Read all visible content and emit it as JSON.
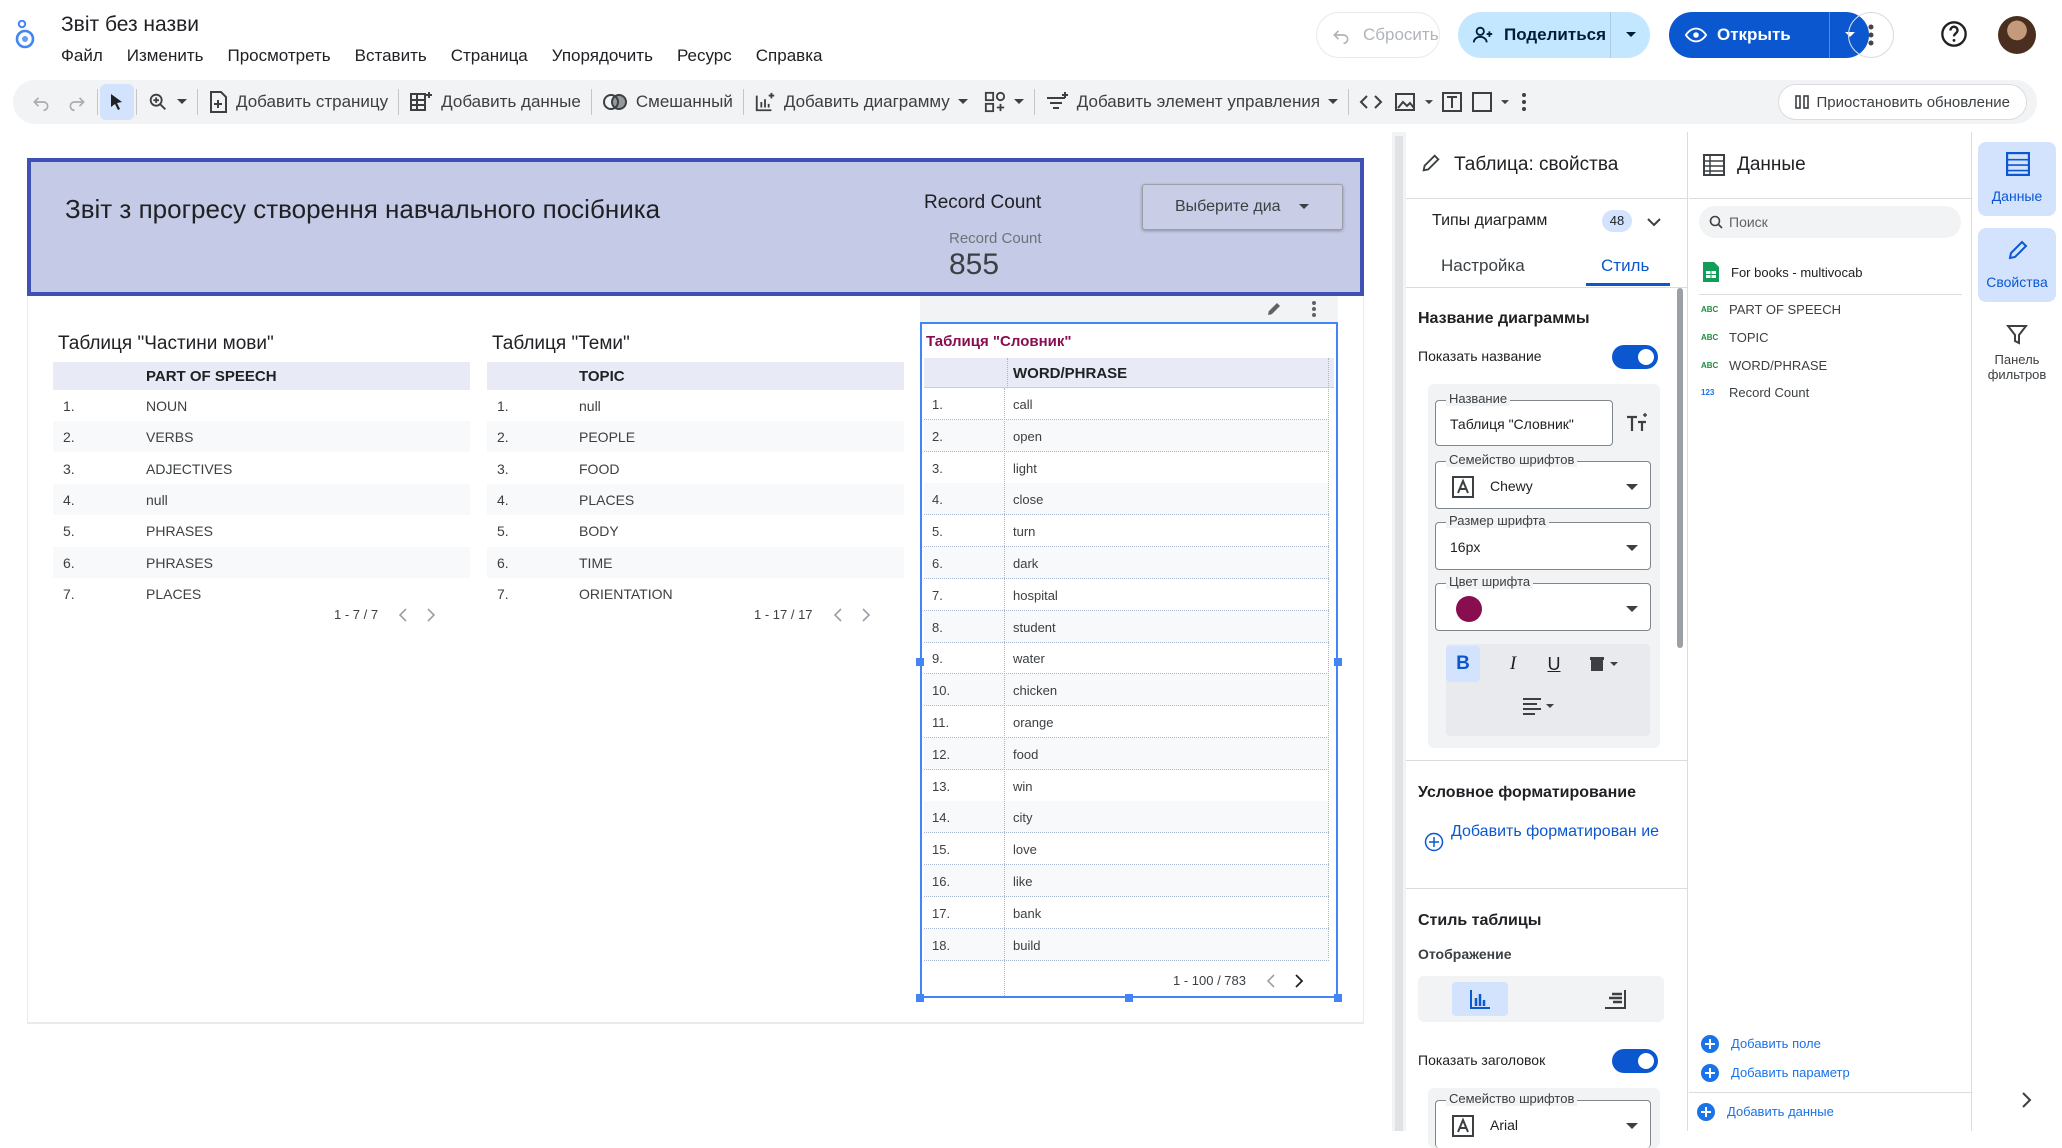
{
  "app": {
    "doc_title": "Звіт без назви"
  },
  "menu": [
    "Файл",
    "Изменить",
    "Просмотреть",
    "Вставить",
    "Страница",
    "Упорядочить",
    "Ресурс",
    "Справка"
  ],
  "header_buttons": {
    "reset": "Сбросить",
    "share": "Поделиться",
    "open": "Открыть"
  },
  "toolbar": {
    "add_page": "Добавить страницу",
    "add_data": "Добавить данные",
    "blend": "Смешанный",
    "add_chart": "Добавить диаграмму",
    "add_control": "Добавить элемент управления",
    "pause": "Приостановить обновление"
  },
  "banner": {
    "title": "Звіт з прогресу створення навчального посібника",
    "scorecard_label": "Record Count",
    "scorecard_small_label": "Record Count",
    "scorecard_value": "855",
    "dropdown": "Выберите диа"
  },
  "table_pos": {
    "title": "Таблиця \"Частини мови\"",
    "header": "PART OF SPEECH",
    "rows": [
      [
        "1.",
        "NOUN"
      ],
      [
        "2.",
        "VERBS"
      ],
      [
        "3.",
        "ADJECTIVES"
      ],
      [
        "4.",
        "null"
      ],
      [
        "5.",
        "PHRASES"
      ],
      [
        "6.",
        "PHRASES"
      ],
      [
        "7.",
        "PLACES"
      ]
    ],
    "pager": "1 - 7 / 7"
  },
  "table_topic": {
    "title": "Таблиця \"Теми\"",
    "header": "TOPIC",
    "rows": [
      [
        "1.",
        "null"
      ],
      [
        "2.",
        "PEOPLE"
      ],
      [
        "3.",
        "FOOD"
      ],
      [
        "4.",
        "PLACES"
      ],
      [
        "5.",
        "BODY"
      ],
      [
        "6.",
        "TIME"
      ],
      [
        "7.",
        "ORIENTATION"
      ]
    ],
    "pager": "1 - 17 / 17"
  },
  "table_dict": {
    "title": "Таблиця \"Словник\"",
    "header": "WORD/PHRASE",
    "rows": [
      [
        "1.",
        "call"
      ],
      [
        "2.",
        "open"
      ],
      [
        "3.",
        "light"
      ],
      [
        "4.",
        "close"
      ],
      [
        "5.",
        "turn"
      ],
      [
        "6.",
        "dark"
      ],
      [
        "7.",
        "hospital"
      ],
      [
        "8.",
        "student"
      ],
      [
        "9.",
        "water"
      ],
      [
        "10.",
        "chicken"
      ],
      [
        "11.",
        "orange"
      ],
      [
        "12.",
        "food"
      ],
      [
        "13.",
        "win"
      ],
      [
        "14.",
        "city"
      ],
      [
        "15.",
        "love"
      ],
      [
        "16.",
        "like"
      ],
      [
        "17.",
        "bank"
      ],
      [
        "18.",
        "build"
      ]
    ],
    "pager": "1 - 100 / 783"
  },
  "props": {
    "panel_title": "Таблица: свойства",
    "chart_types": "Типы диаграмм",
    "chart_types_count": "48",
    "tab_setup": "Настройка",
    "tab_style": "Стиль",
    "section_chart_title": "Название диаграммы",
    "show_title": "Показать название",
    "name_label": "Название",
    "name_value": "Таблиця \"Словник\"",
    "font_family_label": "Семейство шрифтов",
    "font_family_value": "Chewy",
    "font_size_label": "Размер шрифта",
    "font_size_value": "16px",
    "font_color_label": "Цвет шрифта",
    "font_color": "#880e4f",
    "cond_format": "Условное форматирование",
    "add_format": "Добавить форматирован ие",
    "table_style": "Стиль таблицы",
    "display": "Отображение",
    "show_header": "Показать заголовок",
    "font_family_label2": "Семейство шрифтов",
    "font_family_value2": "Arial"
  },
  "data_panel": {
    "title": "Данные",
    "search_placeholder": "Поиск",
    "source": "For books - multivocab",
    "fields": [
      [
        "ABC",
        "PART OF SPEECH"
      ],
      [
        "ABC",
        "TOPIC"
      ],
      [
        "ABC",
        "WORD/PHRASE"
      ],
      [
        "123",
        "Record Count"
      ]
    ],
    "add_field": "Добавить поле",
    "add_param": "Добавить параметр",
    "add_data": "Добавить данные"
  },
  "rail": {
    "data": "Данные",
    "props": "Свойства",
    "filters": "Панель фильтров"
  },
  "colors": {
    "accent": "#0b57d0",
    "banner_bg": "#c5cae6",
    "banner_border": "#3f51b5",
    "title_color": "#880e4f"
  }
}
